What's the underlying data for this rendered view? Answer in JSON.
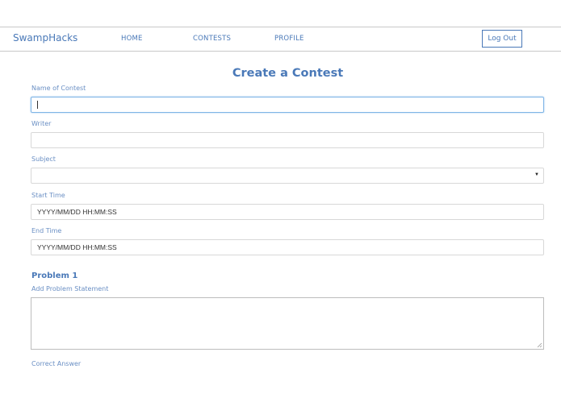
{
  "nav": {
    "brand": "SwampHacks",
    "links": [
      "HOME",
      "CONTESTS",
      "PROFILE"
    ],
    "logout": "Log Out"
  },
  "page": {
    "title": "Create a Contest"
  },
  "form": {
    "name_label": "Name of Contest",
    "name_value": "",
    "writer_label": "Writer",
    "writer_value": "",
    "subject_label": "Subject",
    "subject_value": "",
    "start_label": "Start Time",
    "start_placeholder": "YYYY/MM/DD HH:MM:SS",
    "end_label": "End Time",
    "end_placeholder": "YYYY/MM/DD HH:MM:SS"
  },
  "problem": {
    "title": "Problem 1",
    "statement_label": "Add Problem Statement",
    "statement_value": "",
    "answer_label": "Correct Answer"
  },
  "icons": {
    "select_arrow": "triangle-down-icon",
    "resize": "resize-grip-icon"
  }
}
